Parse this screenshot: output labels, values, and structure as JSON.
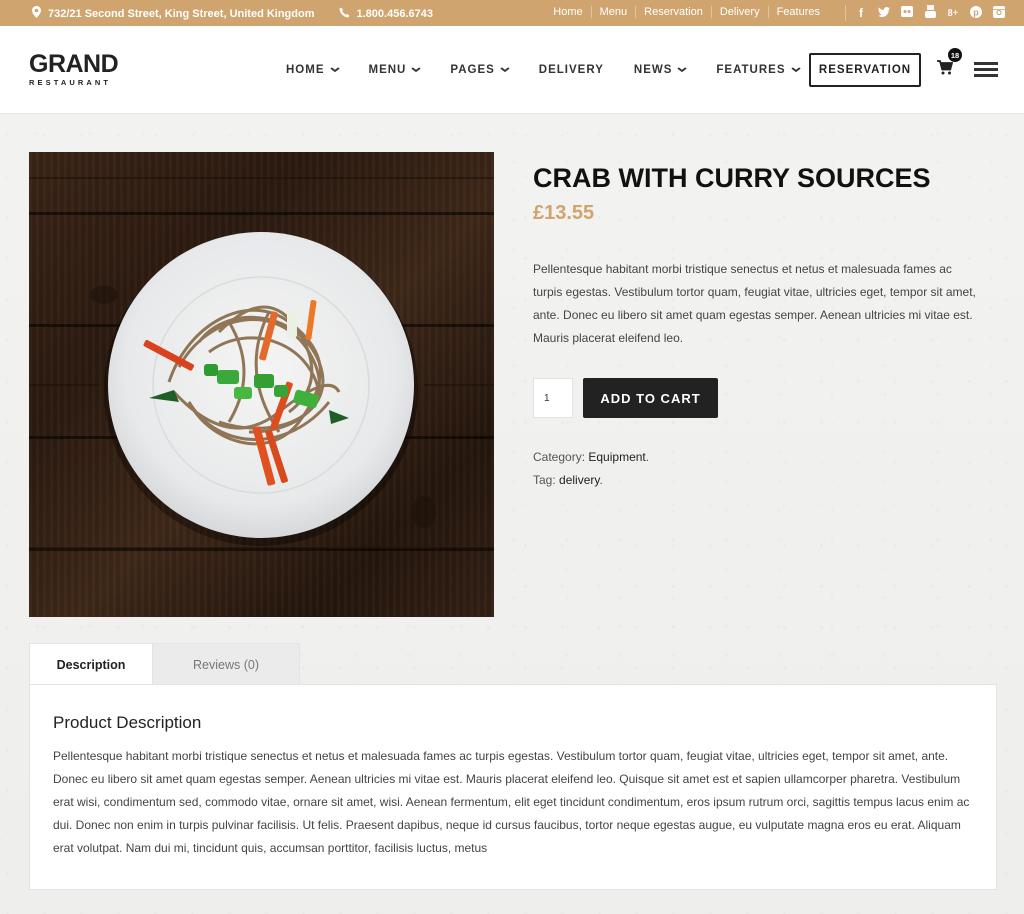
{
  "topbar": {
    "address": "732/21 Second Street, King Street, United Kingdom",
    "phone": "1.800.456.6743",
    "links": [
      "Home",
      "Menu",
      "Reservation",
      "Delivery",
      "Features"
    ],
    "social": [
      "facebook",
      "twitter",
      "flickr",
      "youtube",
      "google-plus",
      "pinterest",
      "instagram"
    ],
    "social_glyphs": {
      "facebook": "f",
      "twitter": "t",
      "google-plus": "8+",
      "pinterest": "p"
    }
  },
  "header": {
    "logo_main": "GRAND",
    "logo_sub": "RESTAURANT",
    "nav": [
      {
        "label": "HOME",
        "dropdown": true
      },
      {
        "label": "MENU",
        "dropdown": true
      },
      {
        "label": "PAGES",
        "dropdown": true
      },
      {
        "label": "DELIVERY",
        "dropdown": false
      },
      {
        "label": "NEWS",
        "dropdown": true
      },
      {
        "label": "FEATURES",
        "dropdown": true
      }
    ],
    "chevron": "⌄",
    "reservation_label": "RESERVATION",
    "cart_count": "18"
  },
  "product": {
    "title": "CRAB WITH CURRY SOURCES",
    "price": "£13.55",
    "short_description": "Pellentesque habitant morbi tristique senectus et netus et malesuada fames ac turpis egestas. Vestibulum tortor quam, feugiat vitae, ultricies eget, tempor sit amet, ante. Donec eu libero sit amet quam egestas semper. Aenean ultricies mi vitae est. Mauris placerat eleifend leo.",
    "quantity": "1",
    "add_to_cart_label": "ADD TO CART",
    "category_label": "Category:",
    "category_value": "Equipment",
    "tag_label": "Tag:",
    "tag_value": "delivery",
    "image_alt": "Soba noodles with carrots and green onion on a white plate on a dark wooden table"
  },
  "tabs": [
    {
      "label": "Description",
      "active": true
    },
    {
      "label": "Reviews (0)",
      "active": false
    }
  ],
  "description_panel": {
    "heading": "Product Description",
    "body": "Pellentesque habitant morbi tristique senectus et netus et malesuada fames ac turpis egestas. Vestibulum tortor quam, feugiat vitae, ultricies eget, tempor sit amet, ante. Donec eu libero sit amet quam egestas semper. Aenean ultricies mi vitae est. Mauris placerat eleifend leo. Quisque sit amet est et sapien ullamcorper pharetra. Vestibulum erat wisi, condimentum sed, commodo vitae, ornare sit amet, wisi. Aenean fermentum, elit eget tincidunt condimentum, eros ipsum rutrum orci, sagittis tempus lacus enim ac dui. Donec non enim in turpis pulvinar facilisis. Ut felis. Praesent dapibus, neque id cursus faucibus, tortor neque egestas augue, eu vulputate magna eros eu erat. Aliquam erat volutpat. Nam dui mi, tincidunt quis, accumsan porttitor, facilisis luctus, metus"
  },
  "colors": {
    "accent": "#cfa46e",
    "dark": "#222222",
    "topbar_bg": "#cfa46e"
  }
}
